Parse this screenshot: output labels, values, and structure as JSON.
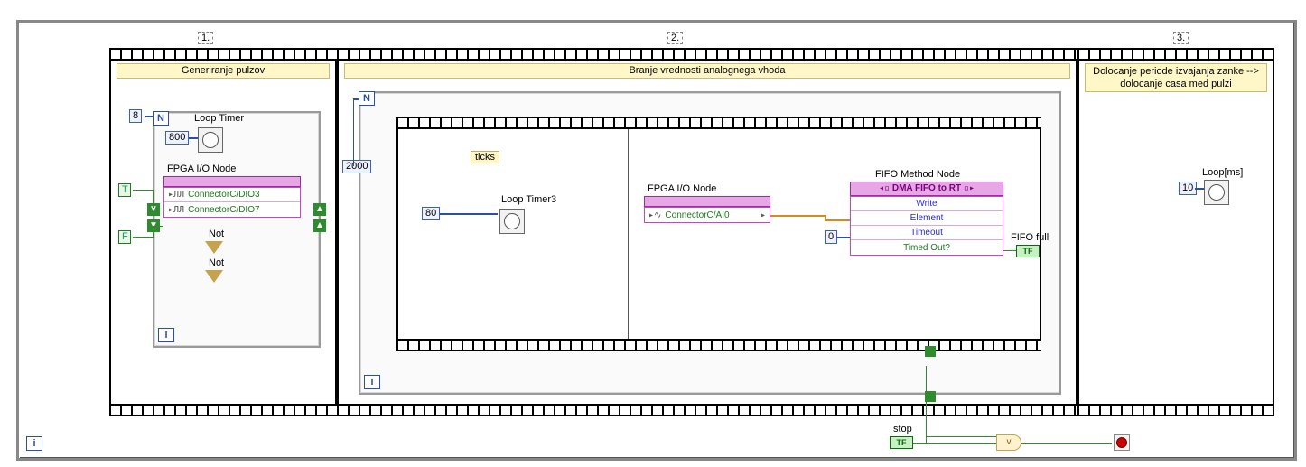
{
  "sequence": {
    "idx1": "1.",
    "idx2": "2.",
    "idx3": "3."
  },
  "frame1": {
    "title": "Generiranje pulzov",
    "loop_N_const": "8",
    "loop_timer_label": "Loop Timer",
    "loop_timer_const": "800",
    "fpga_label": "FPGA I/O Node",
    "io_rows": [
      "ConnectorC/DIO3",
      "ConnectorC/DIO7"
    ],
    "not_label_1": "Not",
    "not_label_2": "Not",
    "bool_true": "T",
    "bool_false": "F"
  },
  "frame2": {
    "title": "Branje vrednosti analognega vhoda",
    "outer_N_const": "2000",
    "ticks_label": "ticks",
    "inner_N_const": "80",
    "loop_timer_label": "Loop Timer3",
    "fpga_label": "FPGA I/O Node",
    "ai_row": "ConnectorC/AI0",
    "fifo_label": "FIFO Method Node",
    "fifo_head": "DMA FIFO to RT",
    "fifo_rows": [
      "Write",
      "Element",
      "Timeout",
      "Timed Out?"
    ],
    "timeout_const": "0",
    "fifo_full_label": "FIFO full"
  },
  "frame3": {
    "title": "Dolocanje periode izvajanja zanke --> dolocanje casa med pulzi",
    "loop_label": "Loop[ms]",
    "loop_const": "10"
  },
  "footer": {
    "stop_label": "stop",
    "or_label": "v"
  }
}
